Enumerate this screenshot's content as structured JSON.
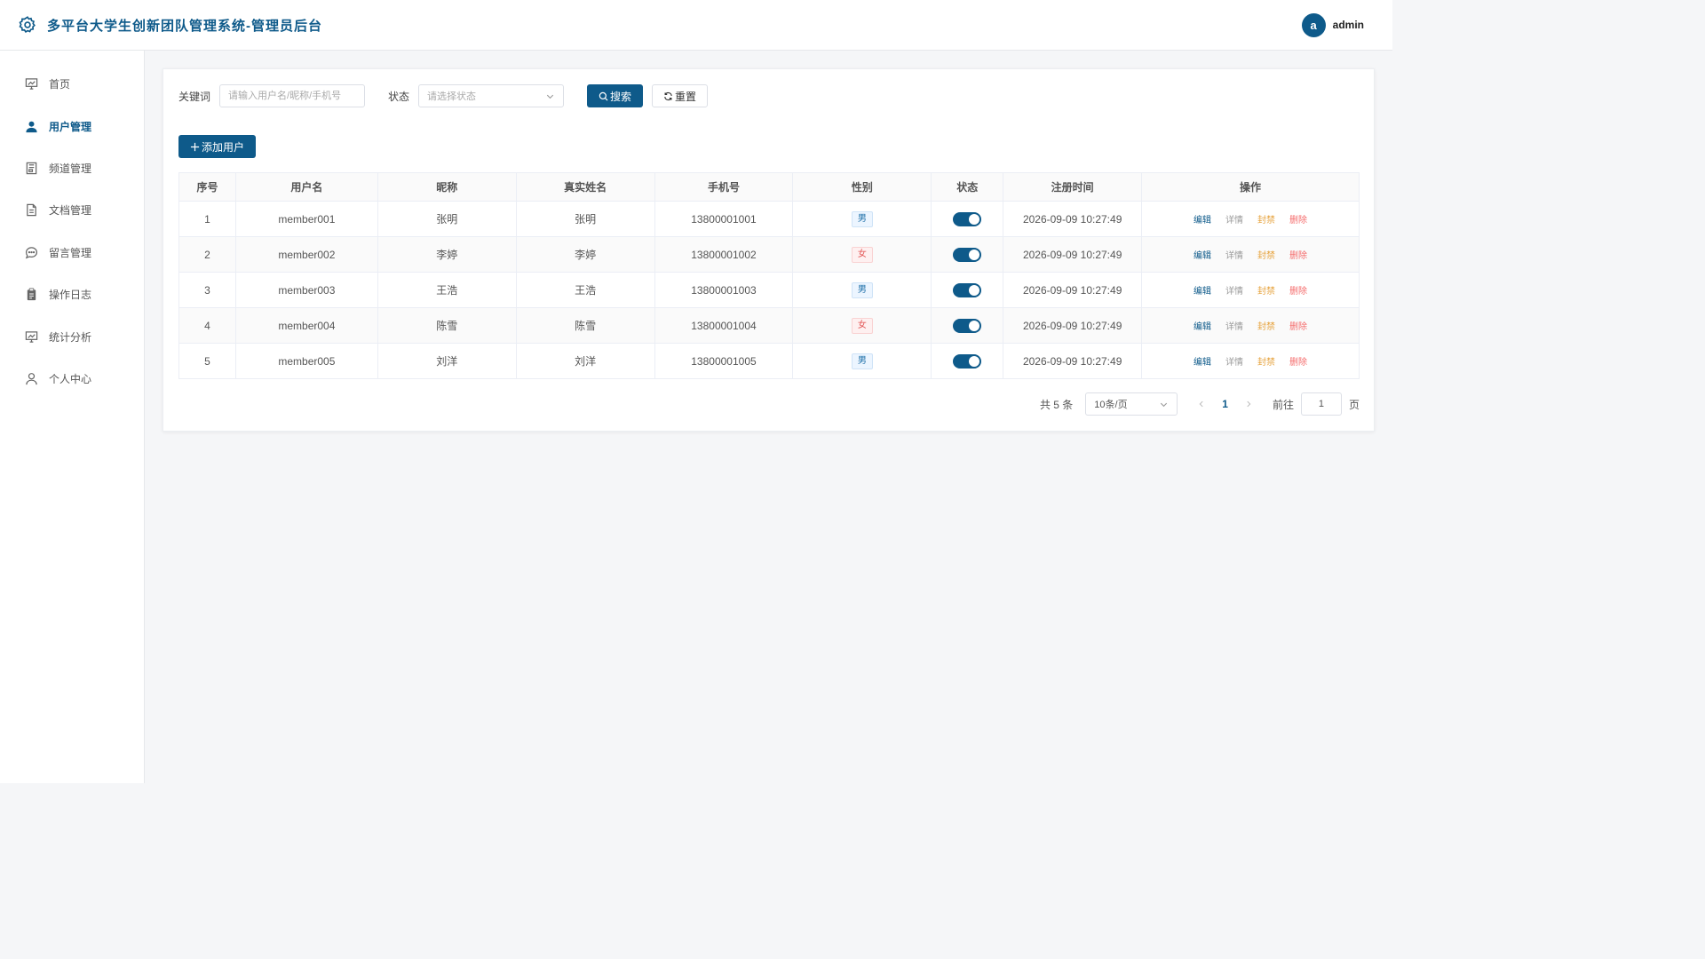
{
  "header": {
    "title": "多平台大学生创新团队管理系统-管理员后台",
    "avatar_letter": "a",
    "username": "admin"
  },
  "sidebar": {
    "items": [
      {
        "label": "首页",
        "icon": "dashboard-icon",
        "active": false
      },
      {
        "label": "用户管理",
        "icon": "user-icon",
        "active": true
      },
      {
        "label": "频道管理",
        "icon": "channel-icon",
        "active": false
      },
      {
        "label": "文档管理",
        "icon": "document-icon",
        "active": false
      },
      {
        "label": "留言管理",
        "icon": "message-icon",
        "active": false
      },
      {
        "label": "操作日志",
        "icon": "log-icon",
        "active": false
      },
      {
        "label": "统计分析",
        "icon": "chart-icon",
        "active": false
      },
      {
        "label": "个人中心",
        "icon": "profile-icon",
        "active": false
      }
    ]
  },
  "filters": {
    "keyword_label": "关键词",
    "keyword_placeholder": "请输入用户名/昵称/手机号",
    "keyword_value": "",
    "status_label": "状态",
    "status_placeholder": "请选择状态",
    "search_label": "搜索",
    "reset_label": "重置"
  },
  "toolbar": {
    "add_label": "添加用户"
  },
  "table": {
    "columns": [
      "序号",
      "用户名",
      "昵称",
      "真实姓名",
      "手机号",
      "性别",
      "状态",
      "注册时间",
      "操作"
    ],
    "rows": [
      {
        "index": "1",
        "username": "member001",
        "nickname": "张明",
        "realname": "张明",
        "phone": "13800001001",
        "gender": "男",
        "status_on": true,
        "registered": "2026-09-09 10:27:49"
      },
      {
        "index": "2",
        "username": "member002",
        "nickname": "李婷",
        "realname": "李婷",
        "phone": "13800001002",
        "gender": "女",
        "status_on": true,
        "registered": "2026-09-09 10:27:49"
      },
      {
        "index": "3",
        "username": "member003",
        "nickname": "王浩",
        "realname": "王浩",
        "phone": "13800001003",
        "gender": "男",
        "status_on": true,
        "registered": "2026-09-09 10:27:49"
      },
      {
        "index": "4",
        "username": "member004",
        "nickname": "陈雪",
        "realname": "陈雪",
        "phone": "13800001004",
        "gender": "女",
        "status_on": true,
        "registered": "2026-09-09 10:27:49"
      },
      {
        "index": "5",
        "username": "member005",
        "nickname": "刘洋",
        "realname": "刘洋",
        "phone": "13800001005",
        "gender": "男",
        "status_on": true,
        "registered": "2026-09-09 10:27:49"
      }
    ],
    "actions": {
      "edit": "编辑",
      "detail": "详情",
      "ban": "封禁",
      "delete": "删除"
    }
  },
  "pagination": {
    "total_text": "共 5 条",
    "page_size": "10条/页",
    "current_page": "1",
    "goto_label": "前往",
    "goto_value": "1",
    "goto_unit": "页"
  },
  "colors": {
    "primary": "#0e5a8a",
    "male_tag": "#1d6fa8",
    "female_tag": "#e25555",
    "ban": "#e6a23c",
    "delete": "#f56c6c"
  }
}
